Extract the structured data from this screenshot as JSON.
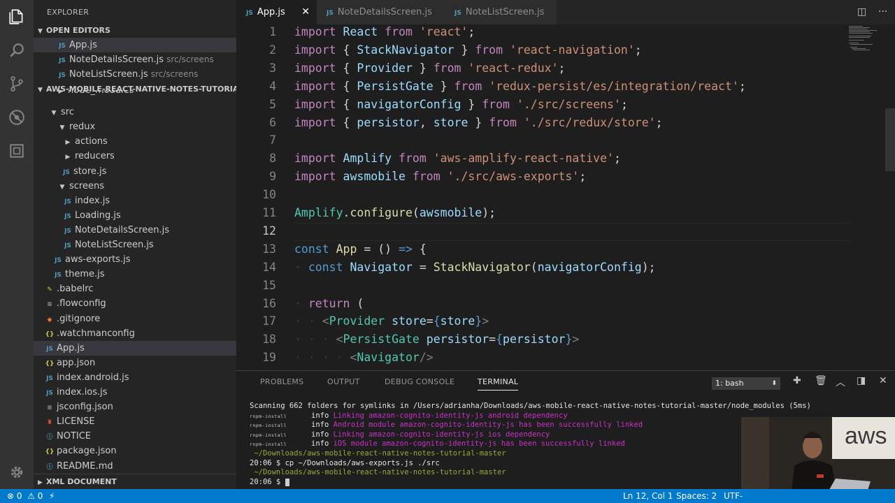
{
  "sidebar": {
    "title": "EXPLORER",
    "open_editors": {
      "header": "OPEN EDITORS",
      "items": [
        {
          "name": "App.js",
          "path": ""
        },
        {
          "name": "NoteDetailsScreen.js",
          "path": "src/screens"
        },
        {
          "name": "NoteListScreen.js",
          "path": "src/screens"
        }
      ]
    },
    "project_header": "AWS-MOBILE-REACT-NATIVE-NOTES-TUTORIAL...",
    "tree": [
      {
        "label": "node_modules",
        "icon": "folder-chevron-right"
      },
      {
        "label": "src",
        "icon": "folder-chevron-down"
      },
      {
        "label": "redux",
        "icon": "folder-chevron-down"
      },
      {
        "label": "actions",
        "icon": "folder-chevron-right"
      },
      {
        "label": "reducers",
        "icon": "folder-chevron-right"
      },
      {
        "label": "store.js",
        "icon": "js-file"
      },
      {
        "label": "screens",
        "icon": "folder-chevron-down"
      },
      {
        "label": "index.js",
        "icon": "js-file"
      },
      {
        "label": "Loading.js",
        "icon": "js-file"
      },
      {
        "label": "NoteDetailsScreen.js",
        "icon": "js-file"
      },
      {
        "label": "NoteListScreen.js",
        "icon": "js-file"
      },
      {
        "label": "aws-exports.js",
        "icon": "js-file"
      },
      {
        "label": "theme.js",
        "icon": "js-file"
      },
      {
        "label": ".babelrc",
        "icon": "babel-file"
      },
      {
        "label": ".flowconfig",
        "icon": "config-file"
      },
      {
        "label": ".gitignore",
        "icon": "git-file"
      },
      {
        "label": ".watchmanconfig",
        "icon": "json-file"
      },
      {
        "label": "App.js",
        "icon": "js-file"
      },
      {
        "label": "app.json",
        "icon": "json-file"
      },
      {
        "label": "index.android.js",
        "icon": "js-file"
      },
      {
        "label": "index.ios.js",
        "icon": "js-file"
      },
      {
        "label": "jsconfig.json",
        "icon": "config-file"
      },
      {
        "label": "LICENSE",
        "icon": "license-file"
      },
      {
        "label": "NOTICE",
        "icon": "info-file"
      },
      {
        "label": "package.json",
        "icon": "json-file"
      },
      {
        "label": "README.md",
        "icon": "info-file"
      }
    ],
    "xml_document_header": "XML DOCUMENT"
  },
  "tabs": [
    {
      "label": "App.js",
      "active": true
    },
    {
      "label": "NoteDetailsScreen.js",
      "active": false
    },
    {
      "label": "NoteListScreen.js",
      "active": false
    }
  ],
  "editor": {
    "line_numbers": [
      "1",
      "2",
      "3",
      "4",
      "5",
      "6",
      "7",
      "8",
      "9",
      "10",
      "11",
      "12",
      "13",
      "14",
      "15",
      "16",
      "17",
      "18",
      "19"
    ],
    "lines": [
      [
        [
          "k",
          "import "
        ],
        [
          "v",
          "React "
        ],
        [
          "k",
          "from "
        ],
        [
          "s",
          "'react'"
        ],
        [
          "p",
          ";"
        ]
      ],
      [
        [
          "k",
          "import "
        ],
        [
          "p",
          "{ "
        ],
        [
          "v",
          "StackNavigator "
        ],
        [
          "p",
          "} "
        ],
        [
          "k",
          "from "
        ],
        [
          "s",
          "'react-navigation'"
        ],
        [
          "p",
          ";"
        ]
      ],
      [
        [
          "k",
          "import "
        ],
        [
          "p",
          "{ "
        ],
        [
          "v",
          "Provider "
        ],
        [
          "p",
          "} "
        ],
        [
          "k",
          "from "
        ],
        [
          "s",
          "'react-redux'"
        ],
        [
          "p",
          ";"
        ]
      ],
      [
        [
          "k",
          "import "
        ],
        [
          "p",
          "{ "
        ],
        [
          "v",
          "PersistGate "
        ],
        [
          "p",
          "} "
        ],
        [
          "k",
          "from "
        ],
        [
          "s",
          "'redux-persist/es/integration/react'"
        ],
        [
          "p",
          ";"
        ]
      ],
      [
        [
          "k",
          "import "
        ],
        [
          "p",
          "{ "
        ],
        [
          "v",
          "navigatorConfig "
        ],
        [
          "p",
          "} "
        ],
        [
          "k",
          "from "
        ],
        [
          "s",
          "'./src/screens'"
        ],
        [
          "p",
          ";"
        ]
      ],
      [
        [
          "k",
          "import "
        ],
        [
          "p",
          "{ "
        ],
        [
          "v",
          "persistor"
        ],
        [
          "p",
          ", "
        ],
        [
          "v",
          "store "
        ],
        [
          "p",
          "} "
        ],
        [
          "k",
          "from "
        ],
        [
          "s",
          "'./src/redux/store'"
        ],
        [
          "p",
          ";"
        ]
      ],
      [],
      [
        [
          "k",
          "import "
        ],
        [
          "v",
          "Amplify "
        ],
        [
          "k",
          "from "
        ],
        [
          "s",
          "'aws-amplify-react-native'"
        ],
        [
          "p",
          ";"
        ]
      ],
      [
        [
          "k",
          "import "
        ],
        [
          "v",
          "awsmobile "
        ],
        [
          "k",
          "from "
        ],
        [
          "s",
          "'./src/aws-exports'"
        ],
        [
          "p",
          ";"
        ]
      ],
      [],
      [
        [
          "t",
          "Amplify"
        ],
        [
          "p",
          "."
        ],
        [
          "f",
          "configure"
        ],
        [
          "p",
          "("
        ],
        [
          "v",
          "awsmobile"
        ],
        [
          "p",
          ");"
        ]
      ],
      [],
      [
        [
          "b",
          "const "
        ],
        [
          "f",
          "App "
        ],
        [
          "p",
          "= () "
        ],
        [
          "b",
          "=> "
        ],
        [
          "p",
          "{"
        ]
      ],
      [
        [
          "ws",
          "· "
        ],
        [
          "b",
          "const "
        ],
        [
          "v",
          "Navigator "
        ],
        [
          "p",
          "= "
        ],
        [
          "f",
          "StackNavigator"
        ],
        [
          "p",
          "("
        ],
        [
          "v",
          "navigatorConfig"
        ],
        [
          "p",
          ");"
        ]
      ],
      [],
      [
        [
          "ws",
          "· "
        ],
        [
          "k",
          "return "
        ],
        [
          "p",
          "("
        ]
      ],
      [
        [
          "ws",
          "· · "
        ],
        [
          "g",
          "<"
        ],
        [
          "t",
          "Provider "
        ],
        [
          "v",
          "store"
        ],
        [
          "p",
          "="
        ],
        [
          "b",
          "{"
        ],
        [
          "v",
          "store"
        ],
        [
          "b",
          "}"
        ],
        [
          "g",
          ">"
        ]
      ],
      [
        [
          "ws",
          "· · · "
        ],
        [
          "g",
          "<"
        ],
        [
          "t",
          "PersistGate "
        ],
        [
          "v",
          "persistor"
        ],
        [
          "p",
          "="
        ],
        [
          "b",
          "{"
        ],
        [
          "v",
          "persistor"
        ],
        [
          "b",
          "}"
        ],
        [
          "g",
          ">"
        ]
      ],
      [
        [
          "ws",
          "· · · · "
        ],
        [
          "g",
          "<"
        ],
        [
          "t",
          "Navigator"
        ],
        [
          "g",
          "/>"
        ]
      ]
    ]
  },
  "panel": {
    "tabs": [
      "PROBLEMS",
      "OUTPUT",
      "DEBUG CONSOLE",
      "TERMINAL"
    ],
    "active_tab": "TERMINAL",
    "terminal_select": "1: bash",
    "terminal_lines": [
      {
        "parts": [
          [
            "dim",
            "Scanning 662 folders for symlinks in /Users/adrianha/Downloads/aws-mobile-react-native-notes-tutorial-master/node_modules (5ms)"
          ]
        ]
      },
      {
        "prefix": "rnpm-install",
        "parts": [
          [
            "dim",
            "info "
          ],
          [
            "mg",
            "Linking amazon-cognito-identity-js android dependency"
          ]
        ]
      },
      {
        "prefix": "rnpm-install",
        "parts": [
          [
            "dim",
            "info "
          ],
          [
            "mg",
            "Android module amazon-cognito-identity-js has been successfully linked"
          ]
        ]
      },
      {
        "prefix": "rnpm-install",
        "parts": [
          [
            "dim",
            "info "
          ],
          [
            "mg",
            "Linking amazon-cognito-identity-js ios dependency"
          ]
        ]
      },
      {
        "prefix": "rnpm-install",
        "parts": [
          [
            "dim",
            "info "
          ],
          [
            "mg",
            "iOS module amazon-cognito-identity-js has been successfully linked"
          ]
        ]
      },
      {
        "parts": [
          [
            "cy",
            " ~/Downloads/aws-mobile-react-native-notes-tutorial-master"
          ]
        ]
      },
      {
        "parts": [
          [
            "dim",
            "20:06 $ cp ~/Downloads/aws-exports.js ./src"
          ]
        ]
      },
      {
        "parts": [
          [
            "cy",
            " ~/Downloads/aws-mobile-react-native-notes-tutorial-master"
          ]
        ]
      },
      {
        "parts": [
          [
            "dim",
            "20:06 $ "
          ]
        ],
        "cursor": true
      }
    ]
  },
  "status": {
    "errors": "0",
    "warnings": "0",
    "position": "Ln 12, Col 1",
    "spaces": "Spaces: 2",
    "encoding": "UTF-"
  },
  "colors": {
    "status_bar": "#007acc",
    "activity_bar": "#333333",
    "sidebar": "#252526",
    "editor": "#1e1e1e"
  }
}
